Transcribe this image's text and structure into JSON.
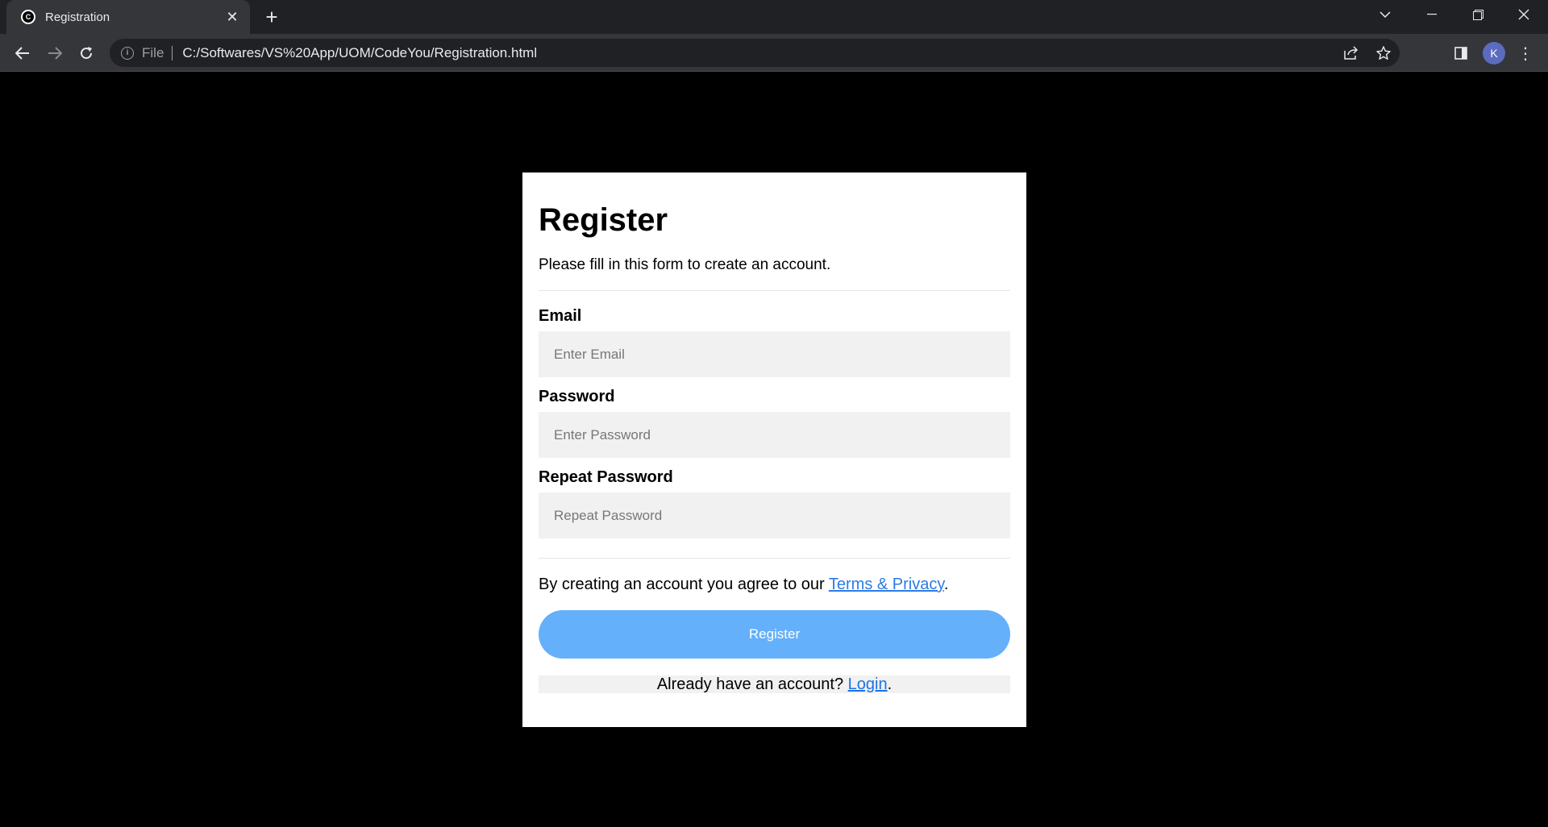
{
  "browser": {
    "tab_title": "Registration",
    "favicon_letter": "C",
    "scheme_label": "File",
    "url": "C:/Softwares/VS%20App/UOM/CodeYou/Registration.html",
    "profile_initial": "K"
  },
  "form": {
    "title": "Register",
    "subtitle": "Please fill in this form to create an account.",
    "email_label": "Email",
    "email_placeholder": "Enter Email",
    "password_label": "Password",
    "password_placeholder": "Enter Password",
    "repeat_label": "Repeat Password",
    "repeat_placeholder": "Repeat Password",
    "terms_prefix": "By creating an account you agree to our ",
    "terms_link": "Terms & Privacy",
    "terms_suffix": ".",
    "register_button": "Register",
    "signin_prefix": "Already have an account? ",
    "signin_link": "Login",
    "signin_suffix": "."
  },
  "colors": {
    "page_background": "#000000",
    "card_background": "#ffffff",
    "input_background": "#f1f1f1",
    "button_background": "#64b0fb",
    "link": "#2c7be5"
  }
}
